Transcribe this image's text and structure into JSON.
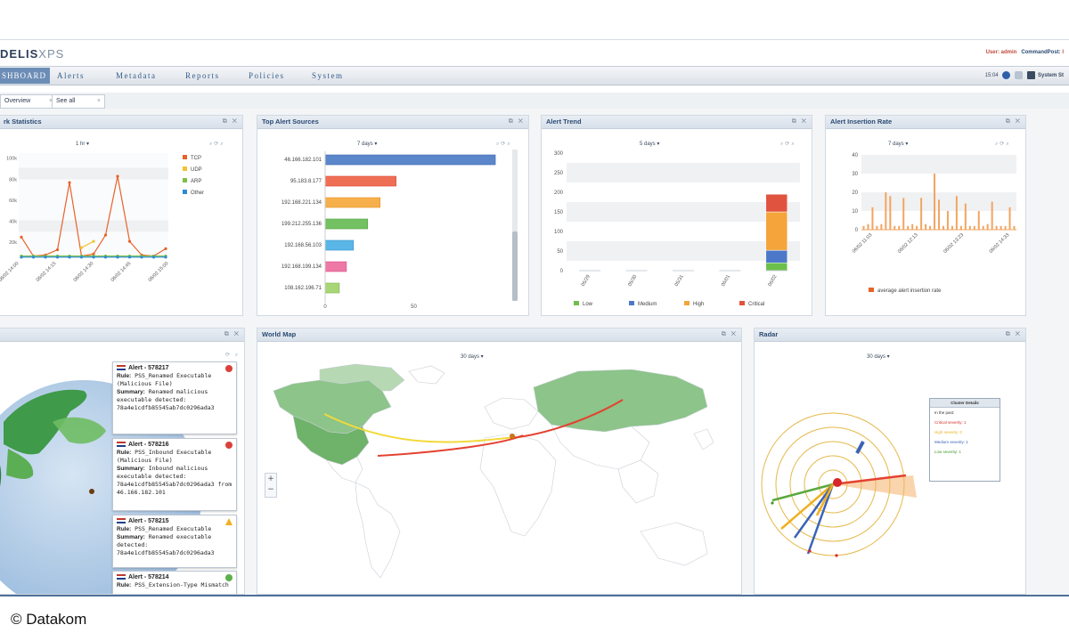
{
  "app": {
    "logo_main": "DELIS",
    "logo_suffix": "XPS",
    "user_label": "User:",
    "user_name": "admin",
    "commandpost_label": "CommandPost:"
  },
  "nav": {
    "active": "SHBOARD",
    "items": [
      "Alerts",
      "Metadata",
      "Reports",
      "Policies",
      "System"
    ],
    "clock": "15:04",
    "system_label": "System St"
  },
  "tabs": [
    {
      "label": "Overview",
      "close": "×"
    },
    {
      "label": "See all",
      "close": "×"
    }
  ],
  "colors": {
    "tcp": "#e8622a",
    "udp": "#f2c230",
    "arp": "#7cc043",
    "other": "#2a8cd6",
    "low": "#6dbf4b",
    "medium": "#4d78c9",
    "high": "#f4a43a",
    "critical": "#e0533f"
  },
  "panels": {
    "net_stats": {
      "title": "rk Statistics",
      "selector": "1 hr"
    },
    "top_sources": {
      "title": "Top Alert Sources",
      "selector": "7 days"
    },
    "alert_trend": {
      "title": "Alert Trend",
      "selector": "5 days"
    },
    "insertion_rate": {
      "title": "Alert Insertion Rate",
      "selector": "7 days"
    },
    "world_map": {
      "title": "World Map",
      "selector": "30 days"
    },
    "radar": {
      "title": "Radar",
      "selector": "30 days"
    }
  },
  "chart_data": [
    {
      "type": "line",
      "title": "rk Statistics",
      "x": [
        "06/02 14:00",
        "06/02 14:15",
        "06/02 14:30",
        "06/02 14:45",
        "06/02 15:00"
      ],
      "yticks": [
        "100k",
        "80k",
        "60k",
        "40k",
        "20k"
      ],
      "ylim": [
        0,
        100
      ],
      "series": [
        {
          "name": "TCP",
          "values": [
            20,
            2,
            3,
            8,
            72,
            2,
            4,
            22,
            78,
            16,
            3,
            2,
            9
          ]
        },
        {
          "name": "UDP",
          "values": [
            null,
            null,
            null,
            null,
            null,
            10,
            16,
            null,
            null,
            null,
            null,
            null,
            null
          ]
        },
        {
          "name": "ARP",
          "values": [
            2,
            2,
            2,
            2,
            2,
            2,
            2,
            2,
            2,
            2,
            2,
            2,
            2
          ]
        },
        {
          "name": "Other",
          "values": [
            1,
            1,
            1,
            1,
            1,
            1,
            1,
            1,
            1,
            1,
            1,
            1,
            1
          ]
        }
      ]
    },
    {
      "type": "bar",
      "title": "Top Alert Sources",
      "categories": [
        "46.166.182.101",
        "95.183.8.177",
        "192.168.221.134",
        "199.212.255.136",
        "192.168.56.103",
        "192.168.199.134",
        "108.162.196.71"
      ],
      "values": [
        96,
        40,
        31,
        24,
        16,
        12,
        8
      ],
      "xticks": [
        "0",
        "50"
      ],
      "xlim": [
        0,
        100
      ]
    },
    {
      "type": "bar",
      "title": "Alert Trend",
      "categories": [
        "05/29",
        "05/30",
        "05/31",
        "06/01",
        "06/02"
      ],
      "yticks": [
        "300",
        "250",
        "200",
        "150",
        "100",
        "50",
        "0"
      ],
      "ylim": [
        0,
        300
      ],
      "series": [
        {
          "name": "Low",
          "values": [
            0,
            0,
            0,
            0,
            20
          ]
        },
        {
          "name": "Medium",
          "values": [
            0,
            0,
            0,
            0,
            32
          ]
        },
        {
          "name": "High",
          "values": [
            0,
            0,
            0,
            0,
            98
          ]
        },
        {
          "name": "Critical",
          "values": [
            0,
            0,
            0,
            0,
            45
          ]
        }
      ]
    },
    {
      "type": "bar",
      "title": "Alert Insertion Rate",
      "x": [
        "06/02 11:03",
        "06/02 12:13",
        "06/02 13:23",
        "06/02 14:33"
      ],
      "yticks": [
        "40",
        "30",
        "20",
        "10",
        "0"
      ],
      "ylim": [
        0,
        40
      ],
      "series": [
        {
          "name": "average alert insertion rate",
          "values": [
            2,
            3,
            12,
            2,
            3,
            20,
            18,
            2,
            2,
            17,
            2,
            3,
            2,
            17,
            3,
            2,
            30,
            16,
            2,
            10,
            2,
            18,
            2,
            14,
            2,
            2,
            10,
            2,
            3,
            15,
            2,
            2,
            2,
            12,
            2
          ]
        }
      ]
    }
  ],
  "alerts": [
    {
      "header": "Alert - 578217",
      "rule_label": "Rule:",
      "rule": "PSS_Renamed Executable (Malicious File)",
      "summary_label": "Summary:",
      "summary": "Renamed malicious executable detected: 78a4e1cdfb85545ab7dc0296ada3",
      "severity": "#d9413a"
    },
    {
      "header": "Alert - 578216",
      "rule_label": "Rule:",
      "rule": "PSS_Inbound Executable (Malicious File)",
      "summary_label": "Summary:",
      "summary": "Inbound malicious executable detected: 78a4e1cdfb85545ab7dc0296ada3 from 46.166.182.101",
      "severity": "#d9413a"
    },
    {
      "header": "Alert - 578215",
      "rule_label": "Rule:",
      "rule": "PSS_Renamed Executable",
      "summary_label": "Summary:",
      "summary": "Renamed executable detected: 78a4e1cdfb85545ab7dc0296ada3",
      "severity": "#f0b020"
    },
    {
      "header": "Alert - 578214",
      "rule_label": "Rule:",
      "rule": "PSS_Extension-Type Mismatch",
      "summary_label": "",
      "summary": "",
      "severity": "#5bb14a"
    }
  ],
  "cluster": {
    "title": "Cluster Details",
    "rows": [
      {
        "text": "In the past:",
        "color": "#333333"
      },
      {
        "text": "Critical severity: 1",
        "color": "#d0342c"
      },
      {
        "text": "High severity: 0",
        "color": "#e6b422"
      },
      {
        "text": "Medium severity: 1",
        "color": "#3b63b8"
      },
      {
        "text": "Low severity: 1",
        "color": "#3f9a2c"
      }
    ]
  },
  "map_zoom": {
    "plus": "+",
    "minus": "−"
  },
  "watermark": "© Datakom"
}
